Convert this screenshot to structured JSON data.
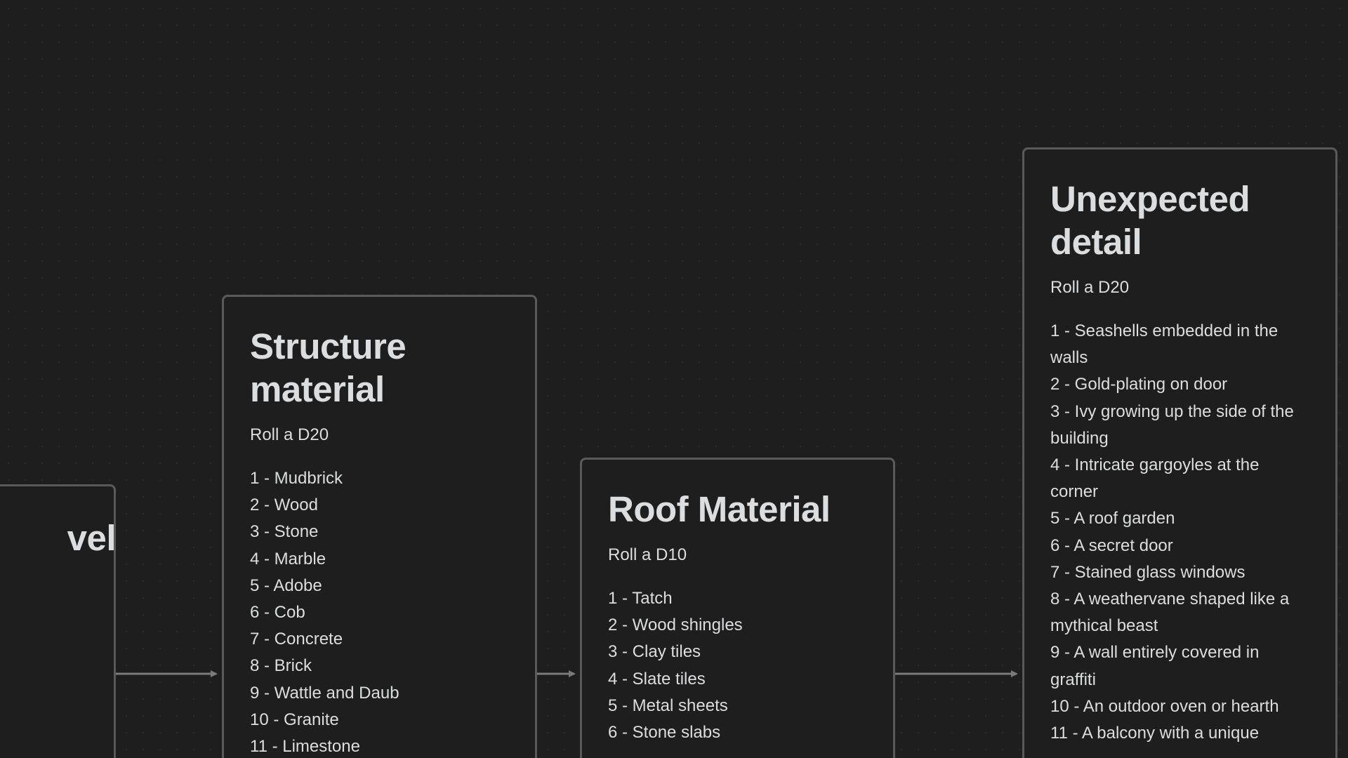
{
  "canvas": {
    "cards": [
      {
        "id": "level",
        "title": "vel",
        "roll": "",
        "items": []
      },
      {
        "id": "structure",
        "title": "Structure material",
        "roll": "Roll a D20",
        "items": [
          "1 - Mudbrick",
          "2 - Wood",
          "3 - Stone",
          "4 - Marble",
          "5 - Adobe",
          "6 - Cob",
          "7 - Concrete",
          "8 - Brick",
          "9 - Wattle and Daub",
          "10 - Granite",
          "11 - Limestone"
        ]
      },
      {
        "id": "roof",
        "title": "Roof Material",
        "roll": "Roll a D10",
        "items": [
          "1 - Tatch",
          "2 - Wood shingles",
          "3 - Clay tiles",
          "4 - Slate tiles",
          "5 - Metal sheets",
          "6 - Stone slabs"
        ]
      },
      {
        "id": "unexpected",
        "title": "Unexpected detail",
        "roll": "Roll a D20",
        "items": [
          "1 - Seashells embedded in the walls",
          "2 - Gold-plating on door",
          "3 - Ivy growing up the side of the building",
          "4 - Intricate gargoyles at the corner",
          "5 - A roof garden",
          "6 - A secret door",
          "7 - Stained glass windows",
          "8 - A weathervane shaped like a mythical beast",
          "9 - A wall entirely covered in graffiti",
          "10 - An outdoor oven or hearth",
          "11 - A balcony with a unique"
        ]
      }
    ],
    "colors": {
      "background": "#1e1e1e",
      "card_border": "#5a5a5a",
      "edge": "#7a7a7a",
      "text": "#dcddde"
    }
  }
}
